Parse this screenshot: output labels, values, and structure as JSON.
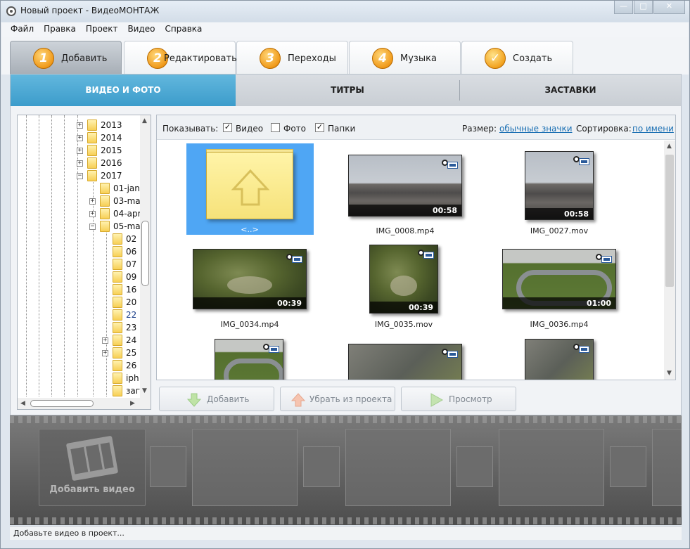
{
  "window": {
    "title": "Новый проект - ВидеоМОНТАЖ",
    "controls": {
      "minimize": "—",
      "maximize": "□",
      "close": "✕"
    }
  },
  "menu": [
    "Файл",
    "Правка",
    "Проект",
    "Видео",
    "Справка"
  ],
  "steps": [
    {
      "number": "1",
      "label": "Добавить",
      "active": true
    },
    {
      "number": "2",
      "label": "Редактировать",
      "active": false
    },
    {
      "number": "3",
      "label": "Переходы",
      "active": false
    },
    {
      "number": "4",
      "label": "Музыка",
      "active": false
    },
    {
      "number": "✓",
      "label": "Создать",
      "active": false
    }
  ],
  "subtabs": [
    "ВИДЕО И ФОТО",
    "ТИТРЫ",
    "ЗАСТАВКИ"
  ],
  "tree": [
    {
      "label": "2013",
      "expander": "+"
    },
    {
      "label": "2014",
      "expander": "+"
    },
    {
      "label": "2015",
      "expander": "+"
    },
    {
      "label": "2016",
      "expander": "+"
    },
    {
      "label": "2017",
      "expander": "−"
    },
    {
      "label": "01-jan",
      "expander": ""
    },
    {
      "label": "03-ma",
      "expander": "+"
    },
    {
      "label": "04-apr",
      "expander": "+"
    },
    {
      "label": "05-ma",
      "expander": "−"
    },
    {
      "label": "02",
      "expander": ""
    },
    {
      "label": "06",
      "expander": ""
    },
    {
      "label": "07",
      "expander": ""
    },
    {
      "label": "09",
      "expander": ""
    },
    {
      "label": "16",
      "expander": ""
    },
    {
      "label": "20",
      "expander": ""
    },
    {
      "label": "22",
      "expander": "",
      "selected": true
    },
    {
      "label": "23",
      "expander": ""
    },
    {
      "label": "24",
      "expander": "+"
    },
    {
      "label": "25",
      "expander": "+"
    },
    {
      "label": "26",
      "expander": ""
    },
    {
      "label": "iph",
      "expander": ""
    },
    {
      "label": "заг",
      "expander": ""
    }
  ],
  "filters": {
    "show_label": "Показывать:",
    "video": {
      "label": "Видео",
      "checked": true
    },
    "photo": {
      "label": "Фото",
      "checked": false
    },
    "folders": {
      "label": "Папки",
      "checked": true
    },
    "size_label": "Размер:",
    "size_value": "обычные значки",
    "sort_label": "Сортировка:",
    "sort_value": "по имени"
  },
  "files": [
    {
      "name": "<..>",
      "kind": "up"
    },
    {
      "name": "IMG_0008.mp4",
      "duration": "00:58",
      "scene": "city"
    },
    {
      "name": "IMG_0027.mov",
      "duration": "00:58",
      "scene": "city"
    },
    {
      "name": "IMG_0034.mp4",
      "duration": "00:39",
      "scene": "aerial"
    },
    {
      "name": "IMG_0035.mov",
      "duration": "00:39",
      "scene": "aerial"
    },
    {
      "name": "IMG_0036.mp4",
      "duration": "01:00",
      "scene": "track"
    },
    {
      "name": "",
      "duration": "",
      "scene": "track"
    },
    {
      "name": "",
      "duration": "",
      "scene": "lot"
    },
    {
      "name": "",
      "duration": "",
      "scene": "lot"
    }
  ],
  "actions": {
    "add": "Добавить",
    "remove": "Убрать из проекта",
    "preview": "Просмотр"
  },
  "filmstrip": {
    "add_video_label": "Добавить видео"
  },
  "status": "Добавьте видео в проект..."
}
